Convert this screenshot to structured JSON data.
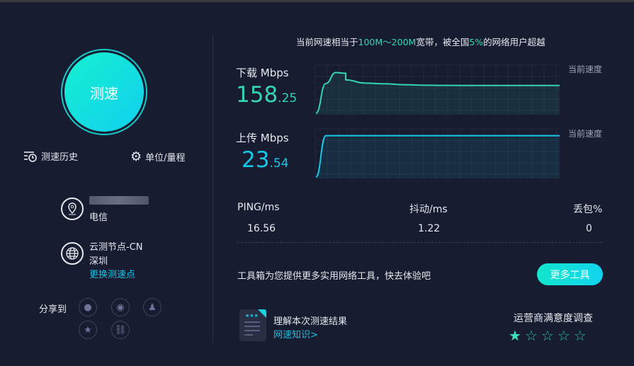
{
  "start_button": "测速",
  "history": "测速历史",
  "units": "单位/量程",
  "isp": {
    "name": "电信"
  },
  "node": {
    "name": "云测节点-CN",
    "city": "深圳",
    "change": "更换测速点"
  },
  "share": {
    "label": "分享到",
    "targets": [
      "wechat",
      "weibo",
      "qq",
      "favorite",
      "link"
    ]
  },
  "summary": {
    "pre": "当前网速相当于",
    "band": "100M～200M",
    "mid": "宽带，被全国",
    "pct": "5%",
    "post": "的网络用户超越"
  },
  "download": {
    "label": "下载",
    "unit": "Mbps",
    "int": "158",
    "dec": ".25",
    "current": "当前速度",
    "color": "#34d6b2",
    "samples": [
      0,
      170,
      232,
      228,
      190,
      172,
      168,
      163,
      160,
      159,
      158.5,
      158.3,
      158.25,
      158.25,
      158.25,
      158.25
    ]
  },
  "upload": {
    "label": "上传",
    "unit": "Mbps",
    "int": "23",
    "dec": ".54",
    "current": "当前速度",
    "color": "#17c7e6",
    "samples": [
      0,
      23.54,
      23.54,
      23.54,
      23.54,
      23.54,
      23.54,
      23.54,
      23.54,
      23.54,
      23.54,
      23.54,
      23.54,
      23.54,
      23.54,
      23.54
    ]
  },
  "stats": [
    {
      "label": "PING/ms",
      "value": "16.56"
    },
    {
      "label": "抖动/ms",
      "value": "1.22"
    },
    {
      "label": "丢包%",
      "value": "0"
    }
  ],
  "tools": {
    "text": "工具箱为您提供更多实用网络工具，快去体验吧",
    "button": "更多工具"
  },
  "knowledge": {
    "title": "理解本次测速结果",
    "link": "网速知识>"
  },
  "survey": {
    "title": "运营商满意度调查",
    "rating": 1,
    "max": 5
  }
}
